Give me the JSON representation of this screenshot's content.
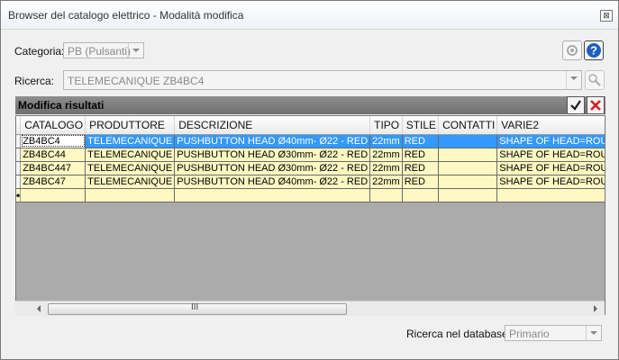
{
  "window": {
    "title": "Browser del catalogo elettrico - Modalità modifica",
    "close_glyph": "⊠"
  },
  "filters": {
    "category_label": "Categoria:",
    "category_value": "PB (Pulsanti)",
    "search_label": "Ricerca:",
    "search_value": "TELEMECANIQUE ZB4BC4"
  },
  "results": {
    "panel_title": "Modifica risultati",
    "columns": [
      "CATALOGO",
      "PRODUTTORE",
      "DESCRIZIONE",
      "TIPO",
      "STILE",
      "CONTATTI",
      "VARIE2"
    ],
    "rows": [
      {
        "cells": [
          "ZB4BC4",
          "TELEMECANIQUE",
          "PUSHBUTTON HEAD Ø40mm- Ø22 - RED",
          "22mm",
          "RED",
          "",
          "SHAPE OF HEAD=ROUND"
        ]
      },
      {
        "cells": [
          "ZB4BC44",
          "TELEMECANIQUE",
          "PUSHBUTTON HEAD Ø30mm- Ø22 - RED",
          "22mm",
          "RED",
          "",
          "SHAPE OF HEAD=ROUND"
        ]
      },
      {
        "cells": [
          "ZB4BC447",
          "TELEMECANIQUE",
          "PUSHBUTTON HEAD Ø30mm- Ø22 - RED",
          "22mm",
          "RED",
          "",
          "SHAPE OF HEAD=ROUND"
        ]
      },
      {
        "cells": [
          "ZB4BC47",
          "TELEMECANIQUE",
          "PUSHBUTTON HEAD Ø40mm- Ø22 - RED",
          "22mm",
          "RED",
          "",
          "SHAPE OF HEAD=ROUND"
        ]
      }
    ],
    "new_row_marker": "•",
    "scroll_grip": "III"
  },
  "footer": {
    "db_label": "Ricerca nel database:",
    "db_value": "Primario"
  },
  "colors": {
    "accent": "#3399ff",
    "row_bg": "#fff8c2",
    "confirm": "#1a1a1a",
    "cancel": "#d42020"
  }
}
